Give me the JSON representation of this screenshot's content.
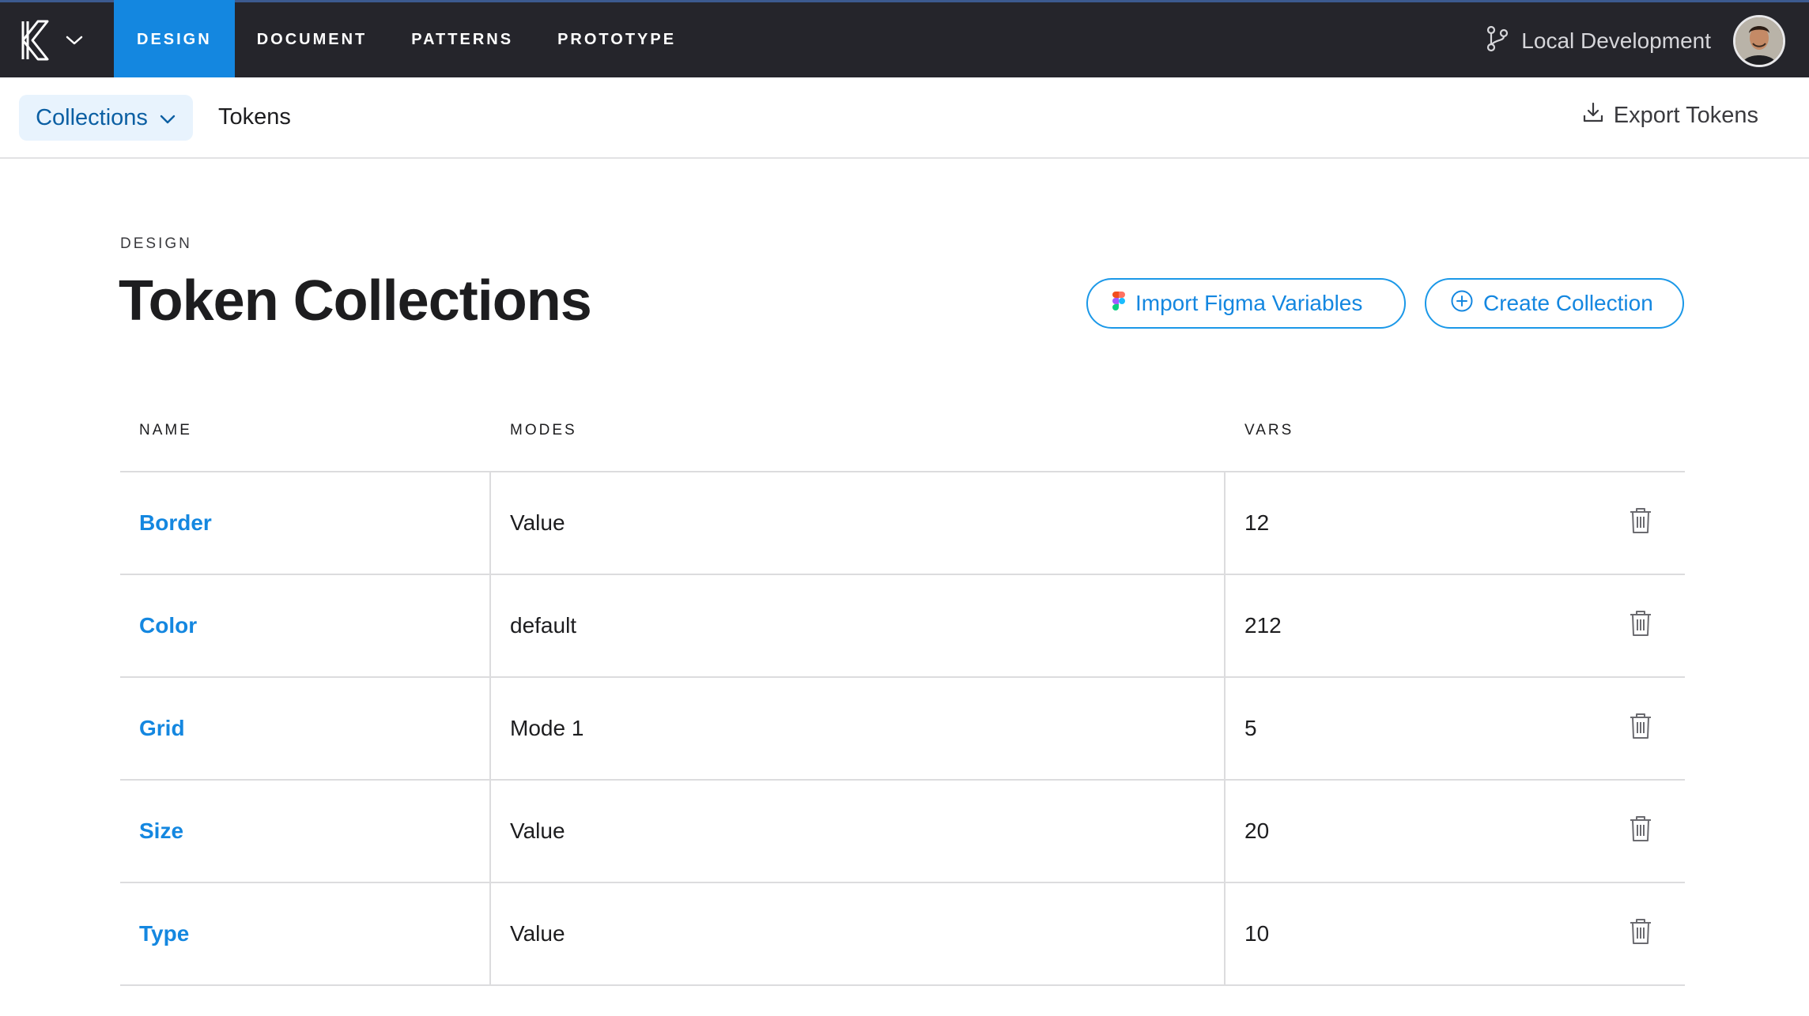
{
  "colors": {
    "topbar": "#25252b",
    "accent": "#1487e0",
    "active_tab": "#1487e0",
    "link": "#1487e0"
  },
  "topbar": {
    "logo_icon": "k-logo-icon",
    "tabs": [
      {
        "label": "DESIGN",
        "active": true
      },
      {
        "label": "DOCUMENT",
        "active": false
      },
      {
        "label": "PATTERNS",
        "active": false
      },
      {
        "label": "PROTOTYPE",
        "active": false
      }
    ],
    "environment": {
      "icon": "branch-icon",
      "label": "Local Development"
    },
    "avatar_icon": "user-avatar"
  },
  "subbar": {
    "collections_label": "Collections",
    "tokens_label": "Tokens",
    "export_label": "Export Tokens",
    "export_icon": "download-icon"
  },
  "header": {
    "eyebrow": "DESIGN",
    "title": "Token Collections",
    "import_label": "Import Figma Variables",
    "create_label": "Create Collection"
  },
  "table": {
    "columns": {
      "name": "NAME",
      "modes": "MODES",
      "vars": "VARS"
    },
    "rows": [
      {
        "name": "Border",
        "modes": "Value",
        "vars": "12"
      },
      {
        "name": "Color",
        "modes": "default",
        "vars": "212"
      },
      {
        "name": "Grid",
        "modes": "Mode 1",
        "vars": "5"
      },
      {
        "name": "Size",
        "modes": "Value",
        "vars": "20"
      },
      {
        "name": "Type",
        "modes": "Value",
        "vars": "10"
      }
    ]
  }
}
